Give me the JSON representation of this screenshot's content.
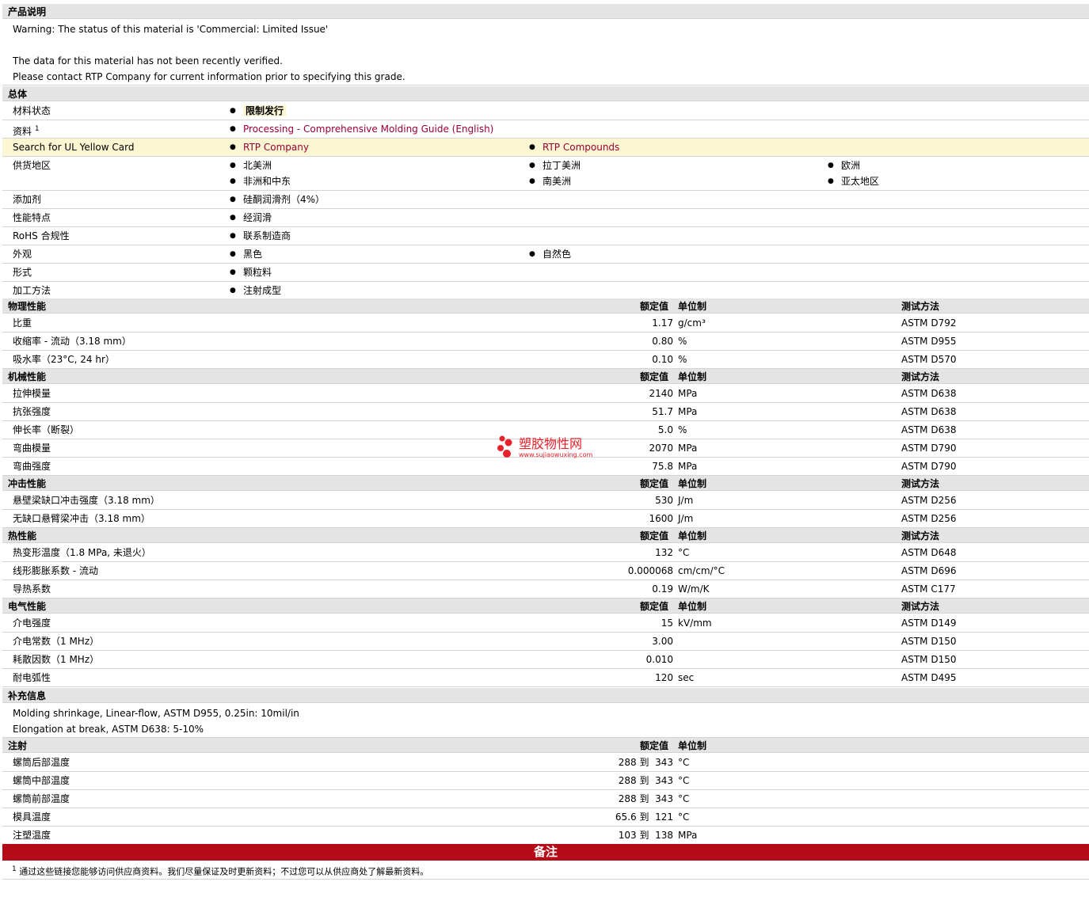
{
  "desc": {
    "header": "产品说明",
    "lines": [
      "Warning: The status of this material is 'Commercial: Limited Issue'",
      "The data for this material has not been recently verified.",
      "Please contact RTP Company for current information prior to specifying this grade."
    ]
  },
  "general": {
    "header": "总体",
    "material_status_label": "材料状态",
    "material_status_value": "限制发行",
    "sources_label": "资料",
    "sources_sup": "1",
    "sources_link": "Processing - Comprehensive Molding Guide (English)",
    "ul_label": "Search for UL Yellow Card",
    "ul_links": [
      "RTP Company",
      "RTP Compounds"
    ],
    "region_label": "供货地区",
    "regions": [
      "北美洲",
      "拉丁美洲",
      "欧洲",
      "非洲和中东",
      "南美洲",
      "亚太地区"
    ],
    "additive_label": "添加剂",
    "additive_value": "硅酮润滑剂（4%）",
    "features_label": "性能特点",
    "features_value": "经润滑",
    "rohs_label": "RoHS 合规性",
    "rohs_value": "联系制造商",
    "appearance_label": "外观",
    "appearance_values": [
      "黑色",
      "自然色"
    ],
    "form_label": "形式",
    "form_value": "颗粒料",
    "processing_label": "加工方法",
    "processing_value": "注射成型"
  },
  "col_headers": {
    "nominal": "额定值",
    "unit": "单位制",
    "test": "测试方法"
  },
  "physical": {
    "header": "物理性能",
    "rows": [
      {
        "name": "比重",
        "value": "1.17",
        "unit": "g/cm³",
        "test": "ASTM D792"
      },
      {
        "name": "收缩率 - 流动（3.18 mm）",
        "value": "0.80",
        "unit": "%",
        "test": "ASTM D955"
      },
      {
        "name": "吸水率（23°C, 24 hr）",
        "value": "0.10",
        "unit": "%",
        "test": "ASTM D570"
      }
    ]
  },
  "mechanical": {
    "header": "机械性能",
    "rows": [
      {
        "name": "拉伸模量",
        "value": "2140",
        "unit": "MPa",
        "test": "ASTM D638"
      },
      {
        "name": "抗张强度",
        "value": "51.7",
        "unit": "MPa",
        "test": "ASTM D638"
      },
      {
        "name": "伸长率（断裂）",
        "value": "5.0",
        "unit": "%",
        "test": "ASTM D638"
      },
      {
        "name": "弯曲模量",
        "value": "2070",
        "unit": "MPa",
        "test": "ASTM D790"
      },
      {
        "name": "弯曲强度",
        "value": "75.8",
        "unit": "MPa",
        "test": "ASTM D790"
      }
    ]
  },
  "impact": {
    "header": "冲击性能",
    "rows": [
      {
        "name": "悬壁梁缺口冲击强度（3.18 mm）",
        "value": "530",
        "unit": "J/m",
        "test": "ASTM D256"
      },
      {
        "name": "无缺口悬臂梁冲击（3.18 mm）",
        "value": "1600",
        "unit": "J/m",
        "test": "ASTM D256"
      }
    ]
  },
  "thermal": {
    "header": "热性能",
    "rows": [
      {
        "name": "热变形温度（1.8 MPa, 未退火）",
        "value": "132",
        "unit": "°C",
        "test": "ASTM D648"
      },
      {
        "name": "线形膨胀系数 - 流动",
        "value": "0.000068",
        "unit": "cm/cm/°C",
        "test": "ASTM D696"
      },
      {
        "name": "导热系数",
        "value": "0.19",
        "unit": "W/m/K",
        "test": "ASTM C177"
      }
    ]
  },
  "electrical": {
    "header": "电气性能",
    "rows": [
      {
        "name": "介电强度",
        "value": "15",
        "unit": "kV/mm",
        "test": "ASTM D149"
      },
      {
        "name": "介电常数（1 MHz）",
        "value": "3.00",
        "unit": "",
        "test": "ASTM D150"
      },
      {
        "name": "耗散因数（1 MHz）",
        "value": "0.010",
        "unit": "",
        "test": "ASTM D150"
      },
      {
        "name": "耐电弧性",
        "value": "120",
        "unit": "sec",
        "test": "ASTM D495"
      }
    ]
  },
  "supplemental": {
    "header": "补充信息",
    "lines": [
      "Molding shrinkage, Linear-flow, ASTM D955, 0.25in: 10mil/in",
      "Elongation at break, ASTM D638: 5-10%"
    ]
  },
  "injection": {
    "header": "注射",
    "rows": [
      {
        "name": "螺筒后部温度",
        "value": "288 到  343",
        "unit": "°C"
      },
      {
        "name": "螺筒中部温度",
        "value": "288 到  343",
        "unit": "°C"
      },
      {
        "name": "螺筒前部温度",
        "value": "288 到  343",
        "unit": "°C"
      },
      {
        "name": "模具温度",
        "value": "65.6 到  121",
        "unit": "°C"
      },
      {
        "name": "注塑温度",
        "value": "103 到  138",
        "unit": "MPa"
      }
    ]
  },
  "notes": {
    "header": "备注",
    "sup": "1",
    "text": "通过这些链接您能够访问供应商资料。我们尽量保证及时更新资料；不过您可以从供应商处了解最新资料。"
  },
  "watermark": {
    "text": "塑胶物性网",
    "url": "www.sujiaowuxing.com"
  }
}
